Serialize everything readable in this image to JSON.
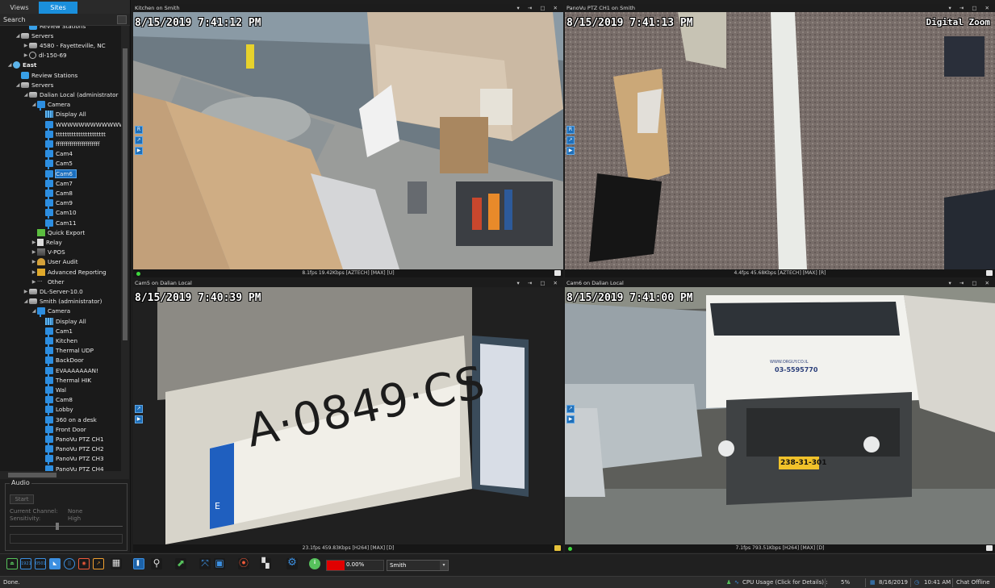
{
  "left_panel": {
    "tabs": [
      "Views",
      "Sites"
    ],
    "active_tab": "Sites",
    "search_label": "Search",
    "tree": [
      {
        "label": "Review Stations",
        "icon": "station-icon",
        "indent": 3,
        "expander": "",
        "partial": true
      },
      {
        "label": "Servers",
        "icon": "server-icon",
        "indent": 2,
        "expander": "◢"
      },
      {
        "label": "4580 - Fayetteville, NC",
        "icon": "server-icon",
        "indent": 3,
        "expander": "▶"
      },
      {
        "label": "dl-150-69",
        "icon": "disk-icon",
        "indent": 3,
        "expander": "▶"
      },
      {
        "label": "East",
        "icon": "globe-icon",
        "indent": 1,
        "expander": "◢",
        "bold": true
      },
      {
        "label": "Review Stations",
        "icon": "station-icon",
        "indent": 2,
        "expander": ""
      },
      {
        "label": "Servers",
        "icon": "server-icon",
        "indent": 2,
        "expander": "◢"
      },
      {
        "label": "Dalian Local (administrator",
        "icon": "server-icon",
        "indent": 3,
        "expander": "◢"
      },
      {
        "label": "Camera",
        "icon": "camera-icon",
        "indent": 4,
        "expander": "◢"
      },
      {
        "label": "Display All",
        "icon": "display-icon",
        "indent": 5,
        "expander": ""
      },
      {
        "label": "WWWWWWWWWWWW",
        "icon": "camera-icon",
        "indent": 5,
        "expander": ""
      },
      {
        "label": "tttttttttttttttttttttt",
        "icon": "camera-icon",
        "indent": 5,
        "expander": ""
      },
      {
        "label": "ffffffffffffffffffffff",
        "icon": "camera-icon",
        "indent": 5,
        "expander": ""
      },
      {
        "label": "Cam4",
        "icon": "camera-icon",
        "indent": 5,
        "expander": ""
      },
      {
        "label": "Cam5",
        "icon": "camera-icon",
        "indent": 5,
        "expander": ""
      },
      {
        "label": "Cam6",
        "icon": "camera-icon",
        "indent": 5,
        "expander": "",
        "selected": true
      },
      {
        "label": "Cam7",
        "icon": "camera-icon",
        "indent": 5,
        "expander": ""
      },
      {
        "label": "Cam8",
        "icon": "camera-icon",
        "indent": 5,
        "expander": ""
      },
      {
        "label": "Cam9",
        "icon": "camera-icon",
        "indent": 5,
        "expander": ""
      },
      {
        "label": "Cam10",
        "icon": "camera-icon",
        "indent": 5,
        "expander": ""
      },
      {
        "label": "Cam11",
        "icon": "camera-icon",
        "indent": 5,
        "expander": ""
      },
      {
        "label": "Quick Export",
        "icon": "export-icon",
        "indent": 4,
        "expander": ""
      },
      {
        "label": "Relay",
        "icon": "relay-icon",
        "indent": 4,
        "expander": "▶"
      },
      {
        "label": "V-POS",
        "icon": "vpos-icon",
        "indent": 4,
        "expander": "▶"
      },
      {
        "label": "User Audit",
        "icon": "audit-icon",
        "indent": 4,
        "expander": "▶"
      },
      {
        "label": "Advanced Reporting",
        "icon": "report-icon",
        "indent": 4,
        "expander": "▶"
      },
      {
        "label": "Other",
        "icon": "dots-icon",
        "indent": 4,
        "expander": "▶"
      },
      {
        "label": "DL-Server-10.0",
        "icon": "server-icon",
        "indent": 3,
        "expander": "▶"
      },
      {
        "label": "Smith (administrator)",
        "icon": "server-icon",
        "indent": 3,
        "expander": "◢"
      },
      {
        "label": "Camera",
        "icon": "camera-icon",
        "indent": 4,
        "expander": "◢"
      },
      {
        "label": "Display All",
        "icon": "display-icon",
        "indent": 5,
        "expander": ""
      },
      {
        "label": "Cam1",
        "icon": "camera-icon",
        "indent": 5,
        "expander": ""
      },
      {
        "label": "Kitchen",
        "icon": "camera-icon",
        "indent": 5,
        "expander": ""
      },
      {
        "label": "Thermal UDP",
        "icon": "camera-icon",
        "indent": 5,
        "expander": ""
      },
      {
        "label": "BackDoor",
        "icon": "camera-icon",
        "indent": 5,
        "expander": ""
      },
      {
        "label": "EVAAAAAAAN!",
        "icon": "camera-icon",
        "indent": 5,
        "expander": ""
      },
      {
        "label": "Thermal HIK",
        "icon": "camera-icon",
        "indent": 5,
        "expander": ""
      },
      {
        "label": "Wal",
        "icon": "camera-icon",
        "indent": 5,
        "expander": ""
      },
      {
        "label": "Cam8",
        "icon": "camera-icon",
        "indent": 5,
        "expander": ""
      },
      {
        "label": "Lobby",
        "icon": "camera-icon",
        "indent": 5,
        "expander": ""
      },
      {
        "label": "360 on a desk",
        "icon": "camera-icon",
        "indent": 5,
        "expander": ""
      },
      {
        "label": "Front Door",
        "icon": "camera-icon",
        "indent": 5,
        "expander": ""
      },
      {
        "label": "PanoVu PTZ CH1",
        "icon": "camera-icon",
        "indent": 5,
        "expander": ""
      },
      {
        "label": "PanoVu PTZ CH2",
        "icon": "camera-icon",
        "indent": 5,
        "expander": ""
      },
      {
        "label": "PanoVu PTZ CH3",
        "icon": "camera-icon",
        "indent": 5,
        "expander": ""
      },
      {
        "label": "PanoVu PTZ CH4",
        "icon": "camera-icon",
        "indent": 5,
        "expander": ""
      }
    ],
    "audio": {
      "title": "Audio",
      "start_button": "Start",
      "current_channel_label": "Current Channel:",
      "current_channel_value": "None",
      "sensitivity_label": "Sensitivity:",
      "sensitivity_value": "High"
    }
  },
  "panes": [
    {
      "title": "Kitchen on Smith",
      "timestamp": "8/15/2019 7:41:12 PM",
      "stats": "8.1fps 19.42Kbps [AZTECH] [MAX] [U]",
      "overlay": ""
    },
    {
      "title": "PanoVu PTZ CH1 on Smith",
      "timestamp": "8/15/2019 7:41:13 PM",
      "stats": "4.4fps 45.68Kbps [AZTECH] [MAX] [R]",
      "overlay": "Digital Zoom"
    },
    {
      "title": "Cam5 on Dalian Local",
      "timestamp": "8/15/2019 7:40:39 PM",
      "stats": "23.1fps 459.83Kbps [H264] [MAX] [D]",
      "overlay": "",
      "plate_text": "A·0849·CS",
      "plate_country": "E"
    },
    {
      "title": "Cam6 on Dalian Local",
      "timestamp": "8/15/2019 7:41:00 PM",
      "stats": "7.1fps 793.51Kbps [H264] [MAX] [D]",
      "overlay": "",
      "truck_plate": "238-31-301",
      "truck_phone": "03-5595770",
      "truck_web": "WWW.ORGUY.CO.IL"
    }
  ],
  "window_buttons": "▾ ⇥ □ ✕",
  "bottom_toolbar": {
    "progress_percent": "0.00%",
    "progress_fill": 0.0,
    "server_selected": "Smith",
    "button_texts": {
      "b1921": "1921",
      "b0501": "0501"
    }
  },
  "status_bar": {
    "left_text": "Done.",
    "cpu_label": "CPU Usage (Click for Details) :",
    "cpu_value": "5%",
    "date": "8/16/2019",
    "time": "10:41 AM",
    "chat": "Chat Offline"
  },
  "colors": {
    "accent": "#1a8fdc",
    "timestamp_text": "#ffffff",
    "progress_red": "#e00000",
    "status_green": "#3ed83e"
  }
}
